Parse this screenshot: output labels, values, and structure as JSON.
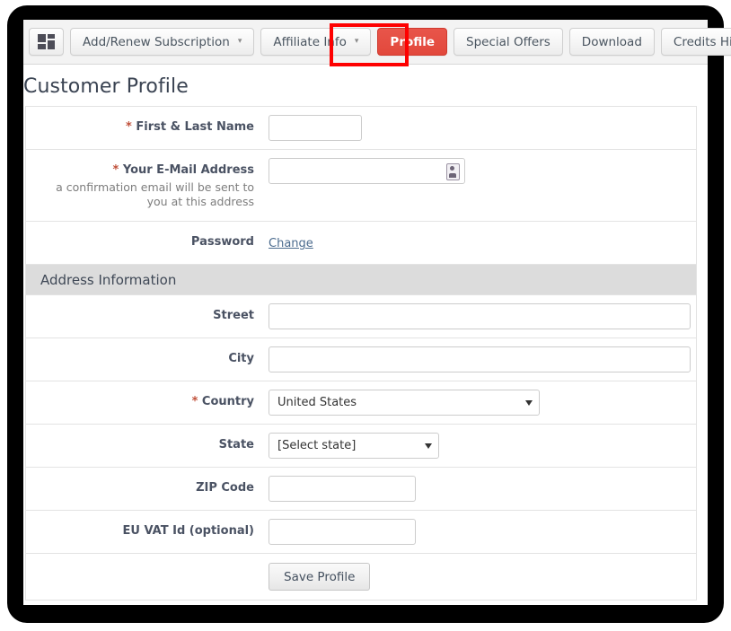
{
  "toolbar": {
    "grid_icon_name": "grid-apps-icon",
    "buttons": [
      {
        "label": "Add/Renew Subscription",
        "has_caret": true,
        "active": false
      },
      {
        "label": "Affiliate Info",
        "has_caret": true,
        "active": false
      },
      {
        "label": "Profile",
        "has_caret": false,
        "active": true
      },
      {
        "label": "Special Offers",
        "has_caret": false,
        "active": false
      },
      {
        "label": "Download",
        "has_caret": false,
        "active": false
      },
      {
        "label": "Credits History",
        "has_caret": false,
        "active": false
      }
    ],
    "caret_glyph": "▾",
    "active_color": "#e2483c",
    "highlight_color": "#fe0000"
  },
  "page": {
    "title": "Customer Profile"
  },
  "form": {
    "name_row": {
      "label_required_mark": "*",
      "label": "First & Last Name",
      "value": "",
      "placeholder": ""
    },
    "email_row": {
      "label_required_mark": "*",
      "label": "Your E-Mail Address",
      "hint": "a confirmation email will be sent to you at this address",
      "value": "",
      "placeholder": "",
      "icon_name": "contact-card-icon"
    },
    "password_row": {
      "label": "Password",
      "link_label": "Change"
    },
    "section_header": {
      "label": "Address Information"
    },
    "street_row": {
      "label": "Street",
      "value": "",
      "placeholder": ""
    },
    "city_row": {
      "label": "City",
      "value": "",
      "placeholder": ""
    },
    "country_row": {
      "label_required_mark": "*",
      "label": "Country",
      "selected": "United States"
    },
    "state_row": {
      "label": "State",
      "selected": "[Select state]"
    },
    "zip_row": {
      "label": "ZIP Code",
      "value": "",
      "placeholder": ""
    },
    "vat_row": {
      "label": "EU VAT Id (optional)",
      "value": "",
      "placeholder": ""
    },
    "save_row": {
      "button_label": "Save Profile"
    }
  }
}
